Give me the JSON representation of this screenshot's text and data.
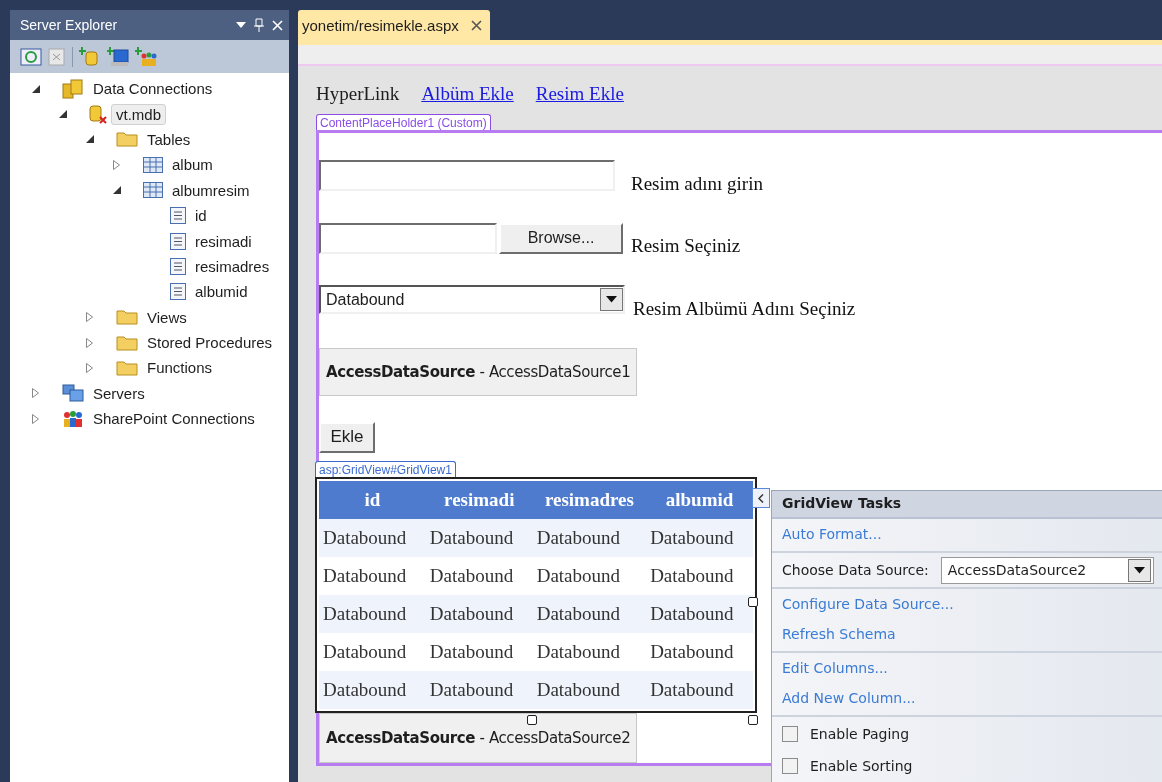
{
  "server_explorer": {
    "title": "Server Explorer",
    "tree": [
      {
        "label": "Data Connections",
        "kind": "connections",
        "expanded": true,
        "selected": false,
        "children": [
          {
            "label": "vt.mdb",
            "kind": "database",
            "expanded": true,
            "selected": true,
            "children": [
              {
                "label": "Tables",
                "kind": "folder",
                "expanded": true,
                "selected": false,
                "children": [
                  {
                    "label": "album",
                    "kind": "table",
                    "expanded": false,
                    "selected": false
                  },
                  {
                    "label": "albumresim",
                    "kind": "table",
                    "expanded": true,
                    "selected": false,
                    "children": [
                      {
                        "label": "id",
                        "kind": "column",
                        "selected": false
                      },
                      {
                        "label": "resimadi",
                        "kind": "column",
                        "selected": false
                      },
                      {
                        "label": "resimadres",
                        "kind": "column",
                        "selected": false
                      },
                      {
                        "label": "albumid",
                        "kind": "column",
                        "selected": false
                      }
                    ]
                  }
                ]
              },
              {
                "label": "Views",
                "kind": "folder",
                "expanded": false,
                "selected": false
              },
              {
                "label": "Stored Procedures",
                "kind": "folder",
                "expanded": false,
                "selected": false
              },
              {
                "label": "Functions",
                "kind": "folder",
                "expanded": false,
                "selected": false
              }
            ]
          }
        ]
      },
      {
        "label": "Servers",
        "kind": "servers",
        "expanded": false,
        "selected": false
      },
      {
        "label": "SharePoint Connections",
        "kind": "sharepoint",
        "expanded": false,
        "selected": false
      }
    ]
  },
  "document_tab": {
    "title": "yonetim/resimekle.aspx"
  },
  "designer": {
    "links": [
      {
        "text": "HyperLink",
        "kind": "plain"
      },
      {
        "text": "Albüm Ekle",
        "kind": "link"
      },
      {
        "text": "Resim Ekle",
        "kind": "link"
      }
    ],
    "placeholder_tag": "ContentPlaceHolder1 (Custom)",
    "form_rows": [
      {
        "kind": "textbox",
        "label": "Resim adını girin"
      },
      {
        "kind": "file",
        "button": "Browse...",
        "label": "Resim Seçiniz"
      },
      {
        "kind": "dropdown",
        "value": "Databound",
        "label": "Resim Albümü Adını Seçiniz"
      }
    ],
    "data_source_1": "**AccessDataSource** - AccessDataSource1",
    "submit_button": "Ekle",
    "grid": {
      "tag": "asp:GridView#GridView1",
      "columns": [
        "id",
        "resimadi",
        "resimadres",
        "albumid"
      ],
      "rows": [
        [
          "Databound",
          "Databound",
          "Databound",
          "Databound"
        ],
        [
          "Databound",
          "Databound",
          "Databound",
          "Databound"
        ],
        [
          "Databound",
          "Databound",
          "Databound",
          "Databound"
        ],
        [
          "Databound",
          "Databound",
          "Databound",
          "Databound"
        ],
        [
          "Databound",
          "Databound",
          "Databound",
          "Databound"
        ]
      ]
    },
    "data_source_2": "**AccessDataSource** - AccessDataSource2"
  },
  "tasks_panel": {
    "title": "GridView Tasks",
    "groups": [
      [
        {
          "kind": "link",
          "text": "Auto Format..."
        }
      ],
      [
        {
          "kind": "select",
          "label": "Choose Data Source:",
          "value": "AccessDataSource2"
        }
      ],
      [
        {
          "kind": "link",
          "text": "Configure Data Source..."
        },
        {
          "kind": "link",
          "text": "Refresh Schema"
        }
      ],
      [
        {
          "kind": "link",
          "text": "Edit Columns..."
        },
        {
          "kind": "link",
          "text": "Add New Column..."
        }
      ],
      [
        {
          "kind": "checkbox",
          "text": "Enable Paging",
          "checked": false
        },
        {
          "kind": "checkbox",
          "text": "Enable Sorting",
          "checked": false
        }
      ]
    ]
  }
}
